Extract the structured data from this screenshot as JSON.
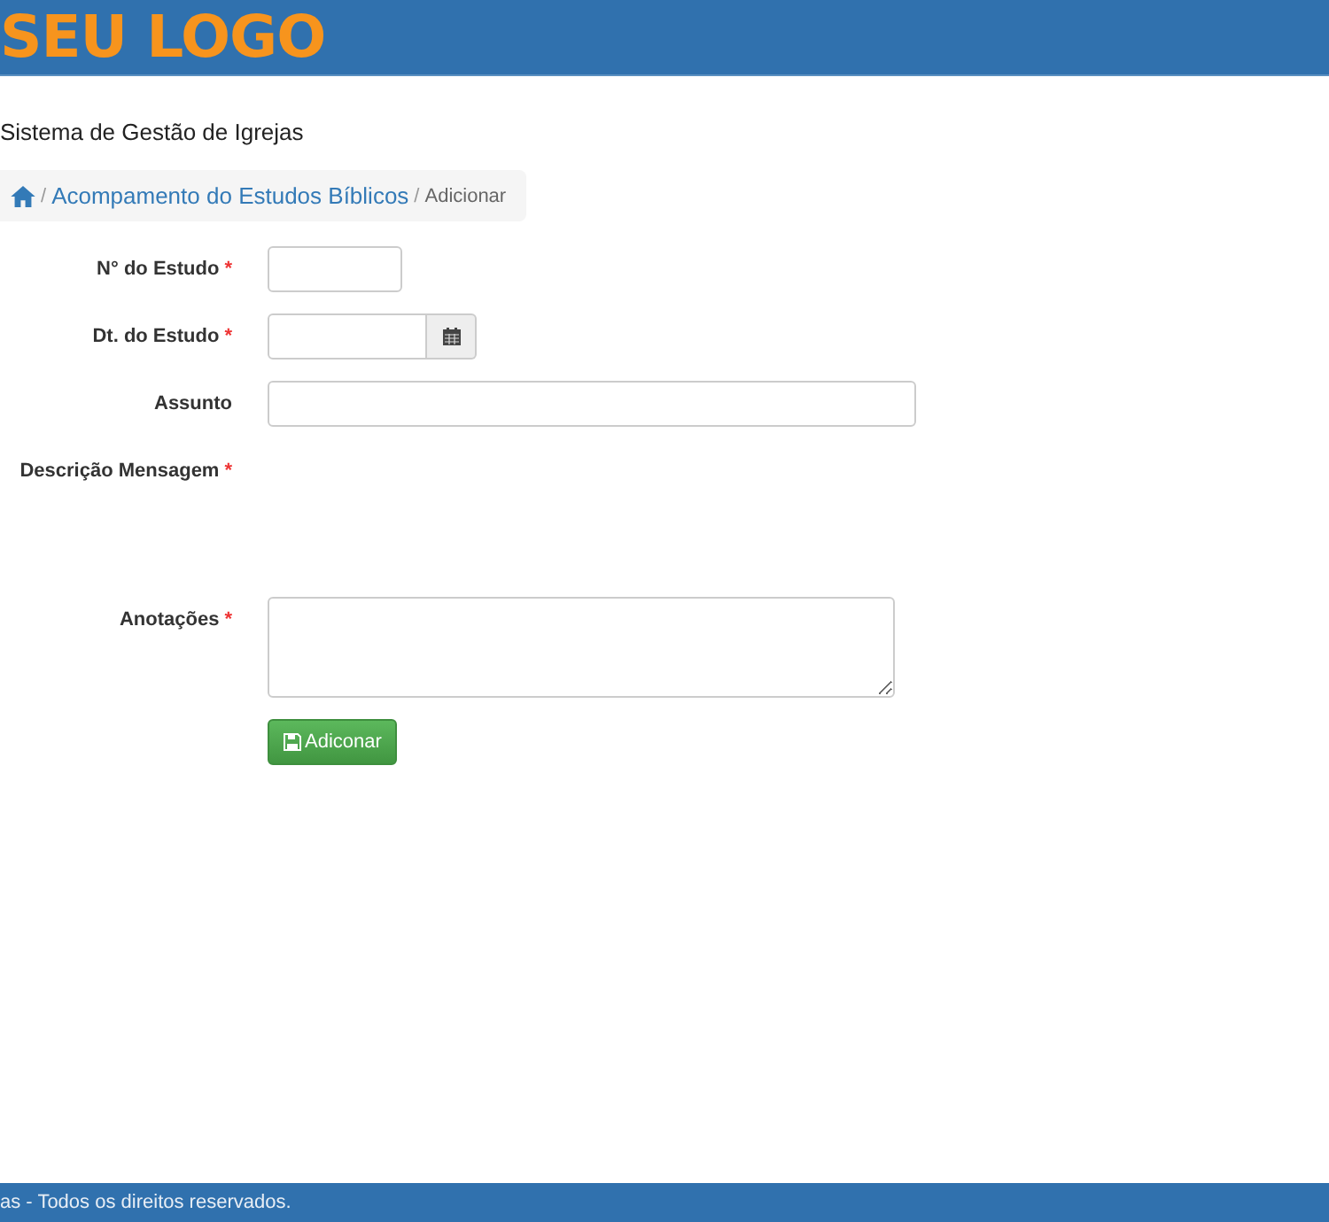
{
  "header": {
    "logo": "SEU LOGO"
  },
  "page_title": "Sistema de Gestão de Igrejas",
  "breadcrumb": [
    {
      "separator": "/",
      "label": "Acompamento do Estudos Bíblicos",
      "kind": "link"
    },
    {
      "separator": "/",
      "label": "Adicionar",
      "kind": "current"
    }
  ],
  "form": {
    "required_mark": "*",
    "fields": [
      {
        "label": "N° do Estudo",
        "required": true,
        "kind": "short"
      },
      {
        "label": "Dt. do Estudo",
        "required": true,
        "kind": "date"
      },
      {
        "label": "Assunto",
        "required": false,
        "kind": "text"
      },
      {
        "label": "Descrição Mensagem",
        "required": true,
        "kind": "empty"
      },
      {
        "label": "Anotações",
        "required": true,
        "kind": "textarea"
      }
    ],
    "submit": "Adiconar"
  },
  "footer": "as - Todos os direitos reservados."
}
